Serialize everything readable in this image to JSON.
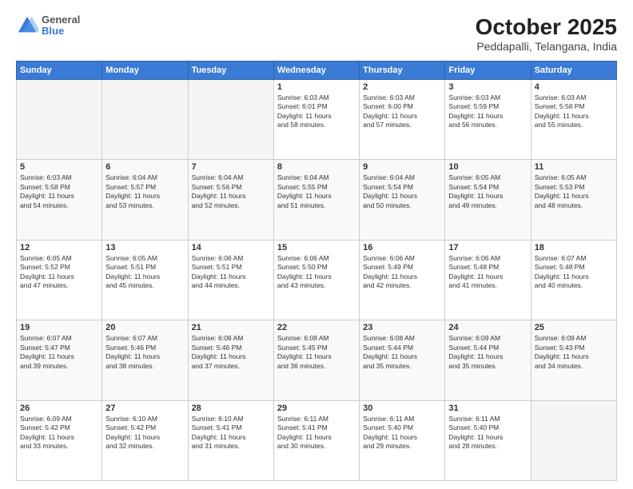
{
  "header": {
    "logo_line1": "General",
    "logo_line2": "Blue",
    "month": "October 2025",
    "location": "Peddapalli, Telangana, India"
  },
  "weekdays": [
    "Sunday",
    "Monday",
    "Tuesday",
    "Wednesday",
    "Thursday",
    "Friday",
    "Saturday"
  ],
  "weeks": [
    [
      {
        "day": "",
        "info": "",
        "empty": true
      },
      {
        "day": "",
        "info": "",
        "empty": true
      },
      {
        "day": "",
        "info": "",
        "empty": true
      },
      {
        "day": "1",
        "info": "Sunrise: 6:03 AM\nSunset: 6:01 PM\nDaylight: 11 hours\nand 58 minutes.",
        "empty": false
      },
      {
        "day": "2",
        "info": "Sunrise: 6:03 AM\nSunset: 6:00 PM\nDaylight: 11 hours\nand 57 minutes.",
        "empty": false
      },
      {
        "day": "3",
        "info": "Sunrise: 6:03 AM\nSunset: 5:59 PM\nDaylight: 11 hours\nand 56 minutes.",
        "empty": false
      },
      {
        "day": "4",
        "info": "Sunrise: 6:03 AM\nSunset: 5:58 PM\nDaylight: 11 hours\nand 55 minutes.",
        "empty": false
      }
    ],
    [
      {
        "day": "5",
        "info": "Sunrise: 6:03 AM\nSunset: 5:58 PM\nDaylight: 11 hours\nand 54 minutes.",
        "empty": false
      },
      {
        "day": "6",
        "info": "Sunrise: 6:04 AM\nSunset: 5:57 PM\nDaylight: 11 hours\nand 53 minutes.",
        "empty": false
      },
      {
        "day": "7",
        "info": "Sunrise: 6:04 AM\nSunset: 5:56 PM\nDaylight: 11 hours\nand 52 minutes.",
        "empty": false
      },
      {
        "day": "8",
        "info": "Sunrise: 6:04 AM\nSunset: 5:55 PM\nDaylight: 11 hours\nand 51 minutes.",
        "empty": false
      },
      {
        "day": "9",
        "info": "Sunrise: 6:04 AM\nSunset: 5:54 PM\nDaylight: 11 hours\nand 50 minutes.",
        "empty": false
      },
      {
        "day": "10",
        "info": "Sunrise: 6:05 AM\nSunset: 5:54 PM\nDaylight: 11 hours\nand 49 minutes.",
        "empty": false
      },
      {
        "day": "11",
        "info": "Sunrise: 6:05 AM\nSunset: 5:53 PM\nDaylight: 11 hours\nand 48 minutes.",
        "empty": false
      }
    ],
    [
      {
        "day": "12",
        "info": "Sunrise: 6:05 AM\nSunset: 5:52 PM\nDaylight: 11 hours\nand 47 minutes.",
        "empty": false
      },
      {
        "day": "13",
        "info": "Sunrise: 6:05 AM\nSunset: 5:51 PM\nDaylight: 11 hours\nand 45 minutes.",
        "empty": false
      },
      {
        "day": "14",
        "info": "Sunrise: 6:06 AM\nSunset: 5:51 PM\nDaylight: 11 hours\nand 44 minutes.",
        "empty": false
      },
      {
        "day": "15",
        "info": "Sunrise: 6:06 AM\nSunset: 5:50 PM\nDaylight: 11 hours\nand 43 minutes.",
        "empty": false
      },
      {
        "day": "16",
        "info": "Sunrise: 6:06 AM\nSunset: 5:49 PM\nDaylight: 11 hours\nand 42 minutes.",
        "empty": false
      },
      {
        "day": "17",
        "info": "Sunrise: 6:06 AM\nSunset: 5:48 PM\nDaylight: 11 hours\nand 41 minutes.",
        "empty": false
      },
      {
        "day": "18",
        "info": "Sunrise: 6:07 AM\nSunset: 5:48 PM\nDaylight: 11 hours\nand 40 minutes.",
        "empty": false
      }
    ],
    [
      {
        "day": "19",
        "info": "Sunrise: 6:07 AM\nSunset: 5:47 PM\nDaylight: 11 hours\nand 39 minutes.",
        "empty": false
      },
      {
        "day": "20",
        "info": "Sunrise: 6:07 AM\nSunset: 5:46 PM\nDaylight: 11 hours\nand 38 minutes.",
        "empty": false
      },
      {
        "day": "21",
        "info": "Sunrise: 6:08 AM\nSunset: 5:46 PM\nDaylight: 11 hours\nand 37 minutes.",
        "empty": false
      },
      {
        "day": "22",
        "info": "Sunrise: 6:08 AM\nSunset: 5:45 PM\nDaylight: 11 hours\nand 36 minutes.",
        "empty": false
      },
      {
        "day": "23",
        "info": "Sunrise: 6:08 AM\nSunset: 5:44 PM\nDaylight: 11 hours\nand 35 minutes.",
        "empty": false
      },
      {
        "day": "24",
        "info": "Sunrise: 6:09 AM\nSunset: 5:44 PM\nDaylight: 11 hours\nand 35 minutes.",
        "empty": false
      },
      {
        "day": "25",
        "info": "Sunrise: 6:09 AM\nSunset: 5:43 PM\nDaylight: 11 hours\nand 34 minutes.",
        "empty": false
      }
    ],
    [
      {
        "day": "26",
        "info": "Sunrise: 6:09 AM\nSunset: 5:42 PM\nDaylight: 11 hours\nand 33 minutes.",
        "empty": false
      },
      {
        "day": "27",
        "info": "Sunrise: 6:10 AM\nSunset: 5:42 PM\nDaylight: 11 hours\nand 32 minutes.",
        "empty": false
      },
      {
        "day": "28",
        "info": "Sunrise: 6:10 AM\nSunset: 5:41 PM\nDaylight: 11 hours\nand 31 minutes.",
        "empty": false
      },
      {
        "day": "29",
        "info": "Sunrise: 6:11 AM\nSunset: 5:41 PM\nDaylight: 11 hours\nand 30 minutes.",
        "empty": false
      },
      {
        "day": "30",
        "info": "Sunrise: 6:11 AM\nSunset: 5:40 PM\nDaylight: 11 hours\nand 29 minutes.",
        "empty": false
      },
      {
        "day": "31",
        "info": "Sunrise: 6:11 AM\nSunset: 5:40 PM\nDaylight: 11 hours\nand 28 minutes.",
        "empty": false
      },
      {
        "day": "",
        "info": "",
        "empty": true
      }
    ]
  ]
}
